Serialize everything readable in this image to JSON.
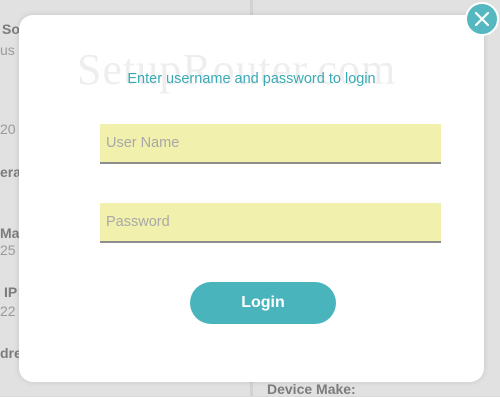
{
  "background": {
    "left_fragments": [
      "So",
      "us",
      "20",
      "era",
      "Mas",
      "25",
      "IP",
      "22",
      "dre"
    ],
    "right_label": "Device Make:"
  },
  "watermark": "SetupRouter.com",
  "dialog": {
    "title": "Enter username and password to login",
    "username_placeholder": "User Name",
    "password_placeholder": "Password",
    "login_label": "Login",
    "close_icon": "close-icon"
  },
  "colors": {
    "accent": "#4ab4bd",
    "title": "#3aaab5",
    "field_bg": "#f2f0ad"
  }
}
